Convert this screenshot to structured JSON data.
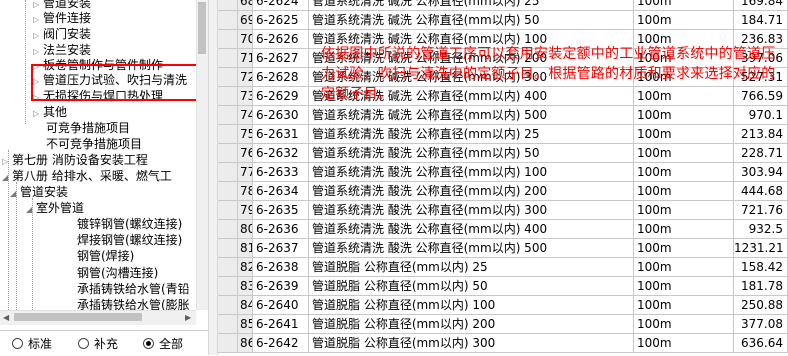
{
  "tree": {
    "items": [
      {
        "label": "管道安装",
        "arrow": "▷"
      },
      {
        "label": "管件连接",
        "arrow": "▷"
      },
      {
        "label": "阀门安装",
        "arrow": "▷"
      },
      {
        "label": "法兰安装",
        "arrow": "▷"
      },
      {
        "label": "板卷管制作与管件制作",
        "arrow": "▷"
      },
      {
        "label": "管道压力试验、吹扫与清洗",
        "arrow": "▷"
      },
      {
        "label": "无损探伤与焊口热处理",
        "arrow": "▷"
      },
      {
        "label": "其他",
        "arrow": "▷"
      },
      {
        "label": "可竞争措施项目",
        "arrow": ""
      },
      {
        "label": "不可竞争措施项目",
        "arrow": ""
      },
      {
        "label": "第七册 消防设备安装工程",
        "arrow": "▷"
      },
      {
        "label": "第八册 给排水、采暖、燃气工",
        "arrow": "◢"
      },
      {
        "label": "管道安装",
        "arrow": "◢"
      },
      {
        "label": "室外管道",
        "arrow": "◢"
      },
      {
        "label": "镀锌钢管(螺纹连接)",
        "arrow": ""
      },
      {
        "label": "焊接钢管(螺纹连接)",
        "arrow": ""
      },
      {
        "label": "钢管(焊接)",
        "arrow": ""
      },
      {
        "label": "钢管(沟槽连接)",
        "arrow": ""
      },
      {
        "label": "承插铸铁给水管(青铅",
        "arrow": ""
      },
      {
        "label": "承插铸铁给水管(膨胀",
        "arrow": ""
      }
    ]
  },
  "filter": {
    "options": [
      {
        "label": "标准",
        "selected": false
      },
      {
        "label": "补充",
        "selected": false
      },
      {
        "label": "全部",
        "selected": true
      }
    ]
  },
  "grid": {
    "rows": [
      {
        "num": "68",
        "code": "6-2624",
        "name": "管道系统清洗 碱洗 公称直径(mm以内) 25",
        "unit": "100m",
        "price": "169.84"
      },
      {
        "num": "69",
        "code": "6-2625",
        "name": "管道系统清洗 碱洗 公称直径(mm以内) 50",
        "unit": "100m",
        "price": "184.71"
      },
      {
        "num": "70",
        "code": "6-2626",
        "name": "管道系统清洗 碱洗 公称直径(mm以内) 100",
        "unit": "100m",
        "price": "236.83"
      },
      {
        "num": "71",
        "code": "6-2627",
        "name": "管道系统清洗 碱洗 公称直径(mm以内) 200",
        "unit": "100m",
        "price": "397.06"
      },
      {
        "num": "72",
        "code": "6-2628",
        "name": "管道系统清洗 碱洗 公称直径(mm以内) 300",
        "unit": "100m",
        "price": "527.31"
      },
      {
        "num": "73",
        "code": "6-2629",
        "name": "管道系统清洗 碱洗 公称直径(mm以内) 400",
        "unit": "100m",
        "price": "766.59"
      },
      {
        "num": "74",
        "code": "6-2630",
        "name": "管道系统清洗 碱洗 公称直径(mm以内) 500",
        "unit": "100m",
        "price": "970.1"
      },
      {
        "num": "75",
        "code": "6-2631",
        "name": "管道系统清洗 酸洗 公称直径(mm以内) 25",
        "unit": "100m",
        "price": "213.84"
      },
      {
        "num": "76",
        "code": "6-2632",
        "name": "管道系统清洗 酸洗 公称直径(mm以内) 50",
        "unit": "100m",
        "price": "228.71"
      },
      {
        "num": "77",
        "code": "6-2633",
        "name": "管道系统清洗 酸洗 公称直径(mm以内) 100",
        "unit": "100m",
        "price": "303.94"
      },
      {
        "num": "78",
        "code": "6-2634",
        "name": "管道系统清洗 酸洗 公称直径(mm以内) 200",
        "unit": "100m",
        "price": "444.68"
      },
      {
        "num": "79",
        "code": "6-2635",
        "name": "管道系统清洗 酸洗 公称直径(mm以内) 300",
        "unit": "100m",
        "price": "721.76"
      },
      {
        "num": "80",
        "code": "6-2636",
        "name": "管道系统清洗 酸洗 公称直径(mm以内) 400",
        "unit": "100m",
        "price": "932.5"
      },
      {
        "num": "81",
        "code": "6-2637",
        "name": "管道系统清洗 酸洗 公称直径(mm以内) 500",
        "unit": "100m",
        "price": "1231.21"
      },
      {
        "num": "82",
        "code": "6-2638",
        "name": "管道脱脂 公称直径(mm以内) 25",
        "unit": "100m",
        "price": "158.42"
      },
      {
        "num": "83",
        "code": "6-2639",
        "name": "管道脱脂 公称直径(mm以内) 50",
        "unit": "100m",
        "price": "181.78"
      },
      {
        "num": "84",
        "code": "6-2640",
        "name": "管道脱脂 公称直径(mm以内) 100",
        "unit": "100m",
        "price": "250.88"
      },
      {
        "num": "85",
        "code": "6-2641",
        "name": "管道脱脂 公称直径(mm以内) 200",
        "unit": "100m",
        "price": "377.08"
      },
      {
        "num": "86",
        "code": "6-2642",
        "name": "管道脱脂 公称直径(mm以内) 300",
        "unit": "100m",
        "price": "636.64"
      }
    ]
  },
  "annotation": {
    "text": "依据图中所说的管道工序可以套用安装定额中的工业管道系统中的管道压力试验、吹扫与清洗中的定额子目。根据管路的材质和要求来选择对应的定额子目。",
    "color": "#ff0000"
  },
  "colors": {
    "highlight_box": "#ff0000",
    "grid_line": "#c8c8c8"
  }
}
